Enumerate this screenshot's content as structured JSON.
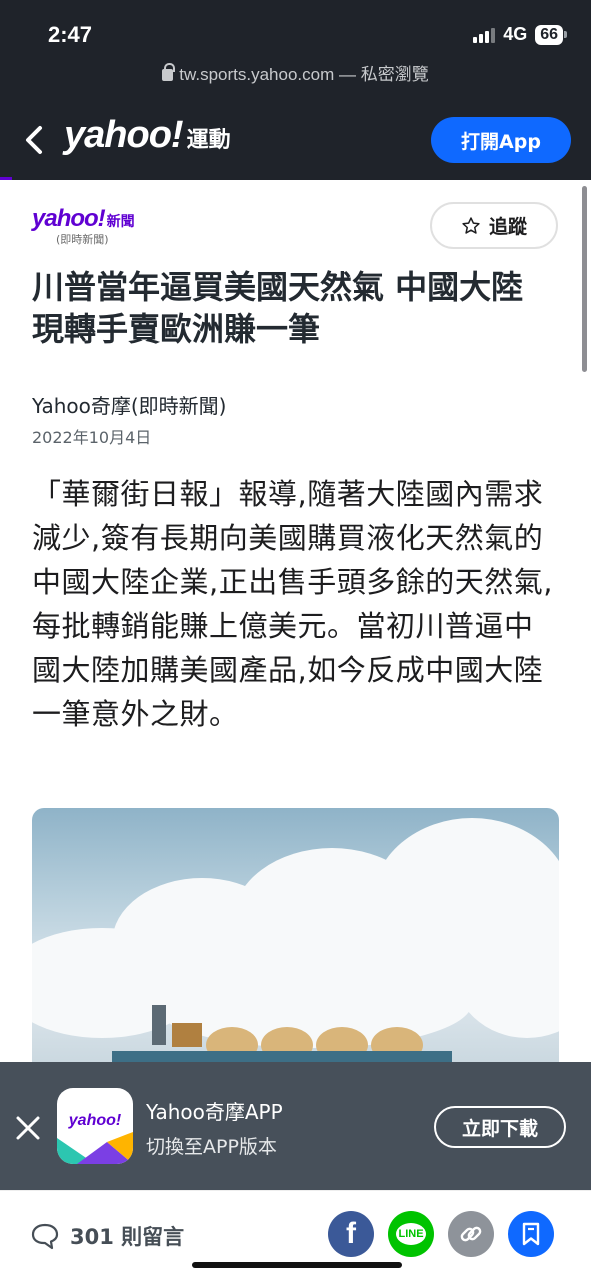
{
  "status": {
    "time": "2:47",
    "network": "4G",
    "battery": "66"
  },
  "browser": {
    "url": "tw.sports.yahoo.com — 私密瀏覽"
  },
  "nav": {
    "brand": "yahoo!",
    "section": "運動",
    "open_app": "打開App",
    "read_progress": 0.02
  },
  "source": {
    "logo": "yahoo!",
    "logo_tag": "新聞",
    "logo_sub": "(即時新聞)",
    "follow": "追蹤"
  },
  "article": {
    "headline": "川普當年逼買美國天然氣 中國大陸現轉手賣歐洲賺一筆",
    "author": "Yahoo奇摩(即時新聞)",
    "date": "2022年10月4日",
    "lede": "「華爾街日報」報導,隨著大陸國內需求減少,簽有長期向美國購買液化天然氣的中國大陸企業,正出售手頭多餘的天然氣,每批轉銷能賺上億美元。當初川普逼中國大陸加購美國產品,如今反成中國大陸一筆意外之財。"
  },
  "app_banner": {
    "icon_text": "yahoo!",
    "title": "Yahoo奇摩APP",
    "subtitle": "切換至APP版本",
    "download": "立即下載"
  },
  "bottom": {
    "comments": "301 則留言",
    "line_label": "LINE"
  },
  "colors": {
    "brand_purple": "#6001d2",
    "accent_blue": "#0f69ff",
    "topbar": "#1f232a",
    "banner": "#47505a"
  }
}
